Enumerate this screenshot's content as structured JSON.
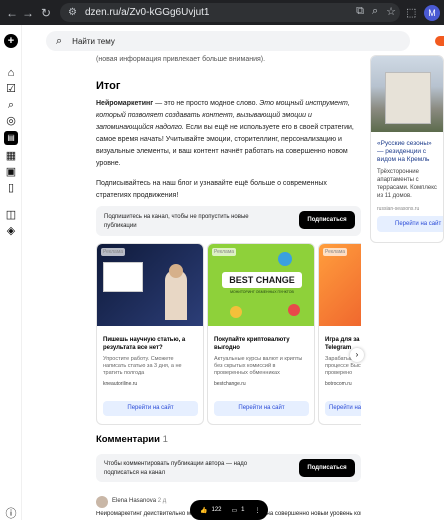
{
  "browser": {
    "url": "dzen.ru/a/Zv0-kGGg6Uvjut1",
    "profile_initial": "M"
  },
  "search": {
    "placeholder": "Найти тему"
  },
  "article": {
    "top_muted": "(новая информация привлекает больше внимания).",
    "heading": "Итог",
    "para1_bold": "Нейромаркетинг",
    "para1_rest": " — это не просто модное слово. ",
    "para1_italic": "Это мощный инструмент, который позволяет создавать контент, вызывающий эмоции и запоминающийся надолго.",
    "para1_tail": " Если вы ещё не используете его в своей стратегии, самое время начать! Учитывайте эмоции, сторителлинг, персонализацию и визуальные элементы, и ваш контент начнёт работать на совершенно новом уровне.",
    "para2": "Подписывайтесь на наш блог и узнавайте ещё больше о современных стратегиях продвижения!"
  },
  "subscribe_banner": {
    "text": "Подпишитесь на канал, чтобы не пропустить новые публикации",
    "button": "Подписаться"
  },
  "cards": [
    {
      "ad_label": "Реклама",
      "title": "Пишешь научную статью, а результата все нет?",
      "desc": "Упростите работу. Сможете написать статью за 3 дня, а не тратить полгода",
      "source": "kneautoriline.ru",
      "button": "Перейти на сайт"
    },
    {
      "ad_label": "Реклама",
      "title": "Покупайте криптовалюту выгодно",
      "desc": "Актуальные курсы валют и крипты без скрытых комиссий в проверенных обменниках",
      "source": "bestchange.ru",
      "button": "Перейти на сайт",
      "logo_text": "BEST CHANGE",
      "logo_sub": "МОНИТОРИНГ ОБМЕННЫХ ПУНКТОВ"
    },
    {
      "ad_label": "Реклама",
      "title": "Игра для за в Telegram",
      "desc": "Зарабатывай в процессе Быстрый и проверено",
      "source": "botrocom.ru",
      "button": "Перейти на сайт"
    }
  ],
  "comments": {
    "title": "Комментарии",
    "count": "1",
    "banner_text": "Чтобы комментировать публикации автора — надо подписаться на канал",
    "banner_button": "Подписаться",
    "author": "Elena Hasanova",
    "age": "2 д",
    "text": "Нейромаркетинг действительно может вывести ваш контент на совершенно новый уровень контента, позволяя"
  },
  "reactions": {
    "likes": "122",
    "comments": "1"
  },
  "right_ad": {
    "title": "«Русские сезоны» — резиденции с видом на Кремль",
    "desc": "Трёхсторонние апартаменты с террасами. Комплекс из 11 домов.",
    "source": "russian-seasons.ru",
    "button": "Перейти на сайт"
  }
}
